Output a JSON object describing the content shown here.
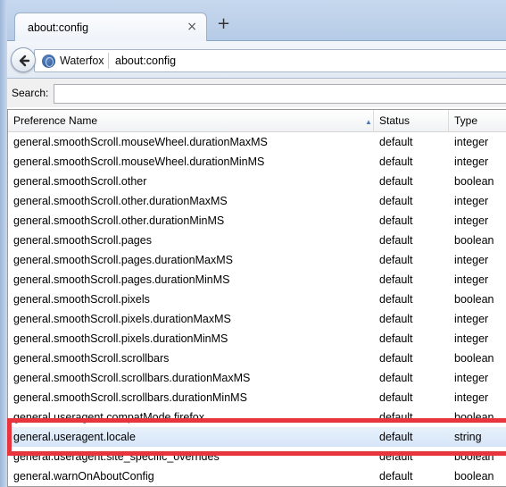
{
  "tab": {
    "title": "about:config",
    "close": "×"
  },
  "newtab": "+",
  "nav": {
    "identity_label": "Waterfox",
    "url": "about:config"
  },
  "search": {
    "label": "Search:",
    "value": ""
  },
  "columns": {
    "name": "Preference Name",
    "status": "Status",
    "type": "Type",
    "sort_arrow": "▲"
  },
  "rows": [
    {
      "name": "general.smoothScroll.mouseWheel.durationMaxMS",
      "status": "default",
      "type": "integer"
    },
    {
      "name": "general.smoothScroll.mouseWheel.durationMinMS",
      "status": "default",
      "type": "integer"
    },
    {
      "name": "general.smoothScroll.other",
      "status": "default",
      "type": "boolean"
    },
    {
      "name": "general.smoothScroll.other.durationMaxMS",
      "status": "default",
      "type": "integer"
    },
    {
      "name": "general.smoothScroll.other.durationMinMS",
      "status": "default",
      "type": "integer"
    },
    {
      "name": "general.smoothScroll.pages",
      "status": "default",
      "type": "boolean"
    },
    {
      "name": "general.smoothScroll.pages.durationMaxMS",
      "status": "default",
      "type": "integer"
    },
    {
      "name": "general.smoothScroll.pages.durationMinMS",
      "status": "default",
      "type": "integer"
    },
    {
      "name": "general.smoothScroll.pixels",
      "status": "default",
      "type": "boolean"
    },
    {
      "name": "general.smoothScroll.pixels.durationMaxMS",
      "status": "default",
      "type": "integer"
    },
    {
      "name": "general.smoothScroll.pixels.durationMinMS",
      "status": "default",
      "type": "integer"
    },
    {
      "name": "general.smoothScroll.scrollbars",
      "status": "default",
      "type": "boolean"
    },
    {
      "name": "general.smoothScroll.scrollbars.durationMaxMS",
      "status": "default",
      "type": "integer"
    },
    {
      "name": "general.smoothScroll.scrollbars.durationMinMS",
      "status": "default",
      "type": "integer"
    },
    {
      "name": "general.useragent.compatMode.firefox",
      "status": "default",
      "type": "boolean"
    },
    {
      "name": "general.useragent.locale",
      "status": "default",
      "type": "string",
      "selected": true
    },
    {
      "name": "general.useragent.site_specific_overrides",
      "status": "default",
      "type": "boolean"
    },
    {
      "name": "general.warnOnAboutConfig",
      "status": "default",
      "type": "boolean"
    }
  ],
  "colors": {
    "highlight": "#e8343c",
    "selection": "#d5e5f8"
  },
  "icons": {
    "back": "back-arrow-icon",
    "identity": "globe-icon",
    "close": "close-icon",
    "sort": "sort-ascending-icon"
  }
}
